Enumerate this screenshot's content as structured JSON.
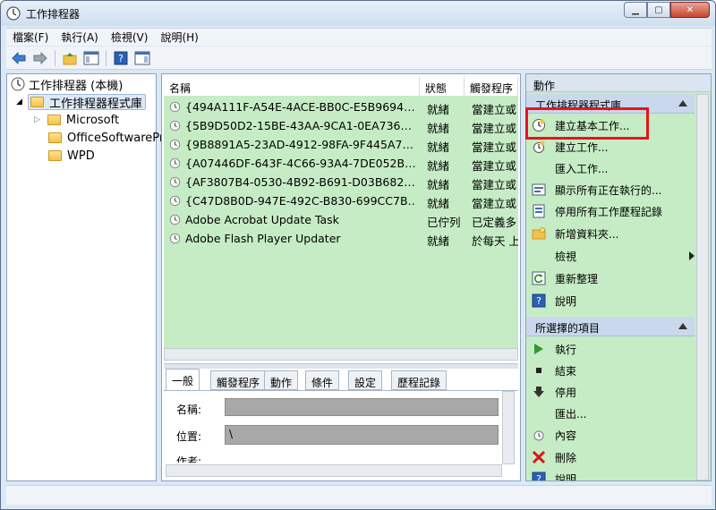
{
  "window": {
    "title": "工作排程器"
  },
  "menu": [
    "檔案(F)",
    "執行(A)",
    "檢視(V)",
    "說明(H)"
  ],
  "tree": {
    "root": "工作排程器 (本機)",
    "library": "工作排程器程式庫",
    "folders": [
      "Microsoft",
      "OfficeSoftwarePr",
      "WPD"
    ]
  },
  "list": {
    "columns": [
      "名稱",
      "狀態",
      "觸發程序"
    ],
    "rows": [
      {
        "name": "{494A111F-A54E-4ACE-BB0C-E5B9694…",
        "status": "就緒",
        "trigger": "當建立或"
      },
      {
        "name": "{5B9D50D2-15BE-43AA-9CA1-0EA736…",
        "status": "就緒",
        "trigger": "當建立或"
      },
      {
        "name": "{9B8891A5-23AD-4912-98FA-9F445A7…",
        "status": "就緒",
        "trigger": "當建立或"
      },
      {
        "name": "{A07446DF-643F-4C66-93A4-7DE052B…",
        "status": "就緒",
        "trigger": "當建立或"
      },
      {
        "name": "{AF3807B4-0530-4B92-B691-D03B682…",
        "status": "就緒",
        "trigger": "當建立或"
      },
      {
        "name": "{C47D8B0D-947E-492C-B830-699CC7B…",
        "status": "就緒",
        "trigger": "當建立或"
      },
      {
        "name": "Adobe Acrobat Update Task",
        "status": "已佇列",
        "trigger": "已定義多"
      },
      {
        "name": "Adobe Flash Player Updater",
        "status": "就緒",
        "trigger": "於每天 上"
      }
    ]
  },
  "tabs": [
    "一般",
    "觸發程序",
    "動作",
    "條件",
    "設定",
    "歷程記錄"
  ],
  "detail": {
    "name_label": "名稱:",
    "location_label": "位置:",
    "location_value": "\\",
    "author_label": "作者:"
  },
  "actions_pane": {
    "title": "動作",
    "section1": "工作排程器程式庫",
    "section1_items": [
      "建立基本工作...",
      "建立工作...",
      "匯入工作...",
      "顯示所有正在執行的...",
      "停用所有工作歷程記錄",
      "新增資料夾...",
      "檢視",
      "重新整理",
      "說明"
    ],
    "section2": "所選擇的項目",
    "section2_items": [
      "執行",
      "結束",
      "停用",
      "匯出...",
      "內容",
      "刪除",
      "說明"
    ]
  },
  "colors": {
    "highlight": "#e8131d",
    "list_bg": "#c6ecc6"
  }
}
